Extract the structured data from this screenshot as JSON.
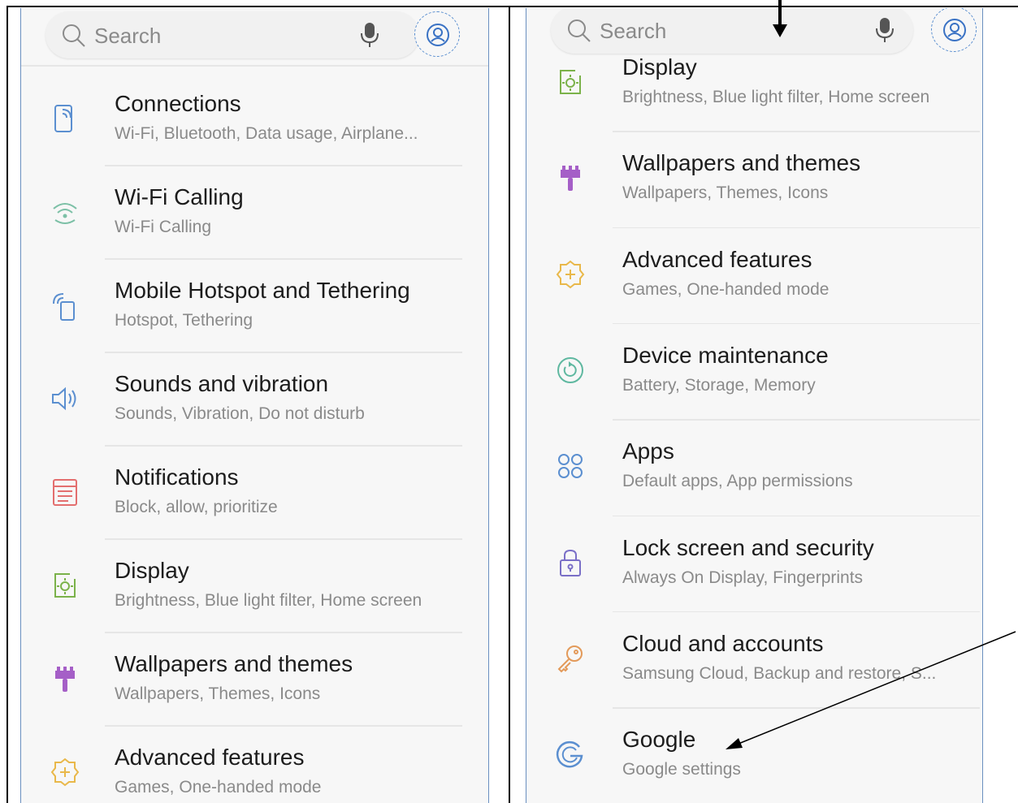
{
  "left_panel": {
    "search": {
      "placeholder": "Search",
      "icon": "search-icon",
      "mic_icon": "microphone-icon",
      "account_icon": "account-icon"
    },
    "items": [
      {
        "title": "Connections",
        "subtitle": "Wi-Fi, Bluetooth, Data usage, Airplane...",
        "icon": "connections-icon",
        "color": "#5b8fd0"
      },
      {
        "title": "Wi-Fi Calling",
        "subtitle": "Wi-Fi Calling",
        "icon": "wifi-calling-icon",
        "color": "#7cc0a6"
      },
      {
        "title": "Mobile Hotspot and Tethering",
        "subtitle": "Hotspot, Tethering",
        "icon": "hotspot-icon",
        "color": "#5b8fd0"
      },
      {
        "title": "Sounds and vibration",
        "subtitle": "Sounds, Vibration, Do not disturb",
        "icon": "sound-icon",
        "color": "#5b8fd0"
      },
      {
        "title": "Notifications",
        "subtitle": "Block, allow, prioritize",
        "icon": "notifications-icon",
        "color": "#e36f6f"
      },
      {
        "title": "Display",
        "subtitle": "Brightness, Blue light filter, Home screen",
        "icon": "display-icon",
        "color": "#7bb24a"
      },
      {
        "title": "Wallpapers and themes",
        "subtitle": "Wallpapers, Themes, Icons",
        "icon": "paintbrush-icon",
        "color": "#a55fc7"
      },
      {
        "title": "Advanced features",
        "subtitle": "Games, One-handed mode",
        "icon": "advanced-features-icon",
        "color": "#e9b84a"
      }
    ]
  },
  "right_panel": {
    "search": {
      "placeholder": "Search",
      "icon": "search-icon",
      "mic_icon": "microphone-icon",
      "account_icon": "account-icon"
    },
    "items": [
      {
        "title": "Display",
        "subtitle": "Brightness, Blue light filter, Home screen",
        "icon": "display-icon",
        "color": "#7bb24a"
      },
      {
        "title": "Wallpapers and themes",
        "subtitle": "Wallpapers, Themes, Icons",
        "icon": "paintbrush-icon",
        "color": "#a55fc7"
      },
      {
        "title": "Advanced features",
        "subtitle": "Games, One-handed mode",
        "icon": "advanced-features-icon",
        "color": "#e9b84a"
      },
      {
        "title": "Device maintenance",
        "subtitle": "Battery, Storage, Memory",
        "icon": "device-maintenance-icon",
        "color": "#5fb8a0"
      },
      {
        "title": "Apps",
        "subtitle": "Default apps, App permissions",
        "icon": "apps-icon",
        "color": "#5b8fd0"
      },
      {
        "title": "Lock screen and security",
        "subtitle": "Always On Display, Fingerprints",
        "icon": "lock-icon",
        "color": "#7a6fc7"
      },
      {
        "title": "Cloud and accounts",
        "subtitle": "Samsung Cloud, Backup and restore, S...",
        "icon": "key-icon",
        "color": "#e39a5a"
      },
      {
        "title": "Google",
        "subtitle": "Google settings",
        "icon": "google-icon",
        "color": "#5b8fd0"
      }
    ]
  },
  "annotations": {
    "scroll_arrow_icon": "down-arrow-icon",
    "pointer_arrow_icon": "pointer-arrow-icon",
    "line_color": "#000000"
  }
}
